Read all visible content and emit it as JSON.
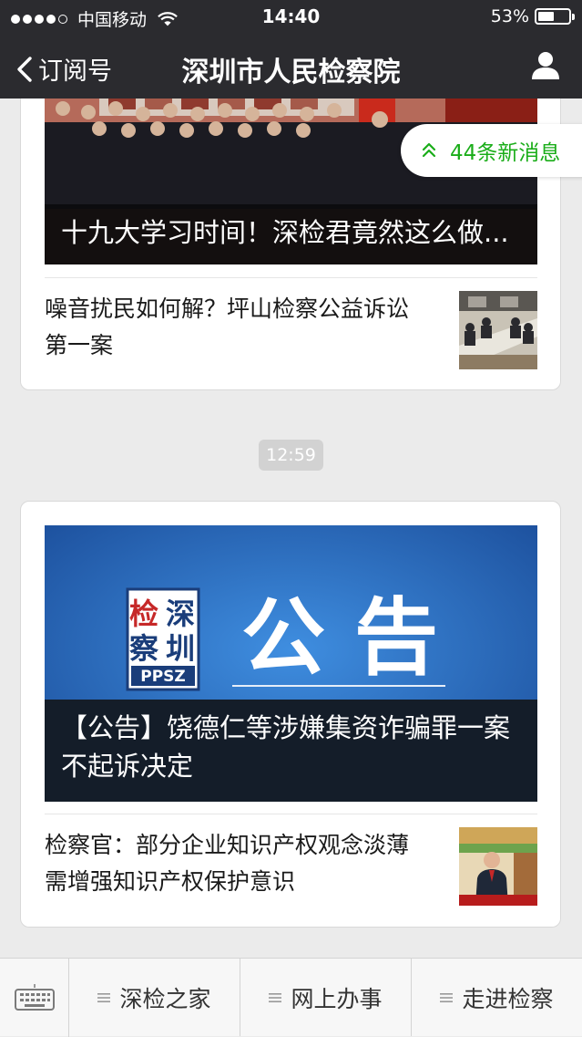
{
  "status_bar": {
    "carrier": "中国移动",
    "time": "14:40",
    "battery": "53%",
    "battery_level": 0.53
  },
  "nav": {
    "back_label": "订阅号",
    "title": "深圳市人民检察院"
  },
  "new_messages": "44条新消息",
  "cards": [
    {
      "headline": "十九大学习时间！深检君竟然这么做...",
      "sub_title": "噪音扰民如何解？坪山检察公益诉讼第一案"
    },
    {
      "banner_text": "公 告",
      "logo_chars": [
        "检",
        "深",
        "察",
        "圳"
      ],
      "logo_caption": "PPSZ",
      "headline": "【公告】饶德仁等涉嫌集资诈骗罪一案不起诉决定",
      "sub_title": "检察官：部分企业知识产权观念淡薄 需增强知识产权保护意识"
    }
  ],
  "timestamp": "12:59",
  "menu": {
    "items": [
      "深检之家",
      "网上办事",
      "走进检察"
    ]
  },
  "colors": {
    "bar": "#2b2b2f",
    "accent_green": "#1aad19",
    "banner_blue": "#2a6fc4"
  }
}
